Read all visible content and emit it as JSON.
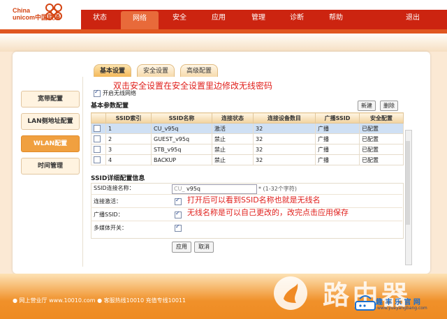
{
  "brand": {
    "line1": "China",
    "line2": "unicom中国联通",
    "color": "#d44412"
  },
  "nav": {
    "items": [
      {
        "label": "状态",
        "x": 0
      },
      {
        "label": "网络",
        "active": true
      },
      {
        "label": "安全"
      },
      {
        "label": "应用"
      },
      {
        "label": "管理"
      },
      {
        "label": "诊断"
      },
      {
        "label": "帮助"
      }
    ],
    "logout": "退出"
  },
  "tabs": [
    {
      "label": "基本设置",
      "active": true
    },
    {
      "label": "安全设置"
    },
    {
      "label": "高级配置"
    }
  ],
  "sidebar": {
    "items": [
      {
        "label": "宽带配置"
      },
      {
        "label": "LAN侧地址配置"
      },
      {
        "label": "WLAN配置",
        "active": true
      },
      {
        "label": "时间管理"
      }
    ]
  },
  "annotations": {
    "top": "双击安全设置在安全设置里边修改无线密码",
    "mid1": "打开后可以看到SSID名称也就是无线名",
    "mid2": "无线名称是可以自己更改的，改完点击应用保存"
  },
  "wlan": {
    "enable_label": "开启无线网络",
    "basic_title": "基本参数配置",
    "new_button": "新建",
    "delete_button": "删除",
    "columns": [
      "",
      "SSID索引",
      "SSID名称",
      "连接状态",
      "连接设备数目",
      "广播SSID",
      "安全配置"
    ],
    "rows": [
      {
        "index": "1",
        "name": "CU_v95q",
        "status": "激活",
        "devices": "32",
        "broadcast": "广播",
        "security": "已配置",
        "selected": true
      },
      {
        "index": "2",
        "name": "GUEST_v95q",
        "status": "禁止",
        "devices": "32",
        "broadcast": "广播",
        "security": "已配置"
      },
      {
        "index": "3",
        "name": "STB_v95q",
        "status": "禁止",
        "devices": "32",
        "broadcast": "广播",
        "security": "已配置"
      },
      {
        "index": "4",
        "name": "BACKUP",
        "status": "禁止",
        "devices": "32",
        "broadcast": "广播",
        "security": "已配置"
      }
    ],
    "detail_title": "SSID详细配置信息",
    "detail": {
      "ssid_name_label": "SSID连接名称：",
      "ssid_prefix": "CU_",
      "ssid_value": "v95q",
      "ssid_hint": "* (1-32个字符)",
      "activate_label": "连接激活：",
      "broadcast_label": "广播SSID：",
      "multimedia_label": "多媒体开关："
    },
    "apply_button": "应用",
    "cancel_button": "取消"
  },
  "footer": {
    "text": "● 网上营业厅  www.10010.com  ● 客服热线10010  充值专线10011"
  },
  "watermark": {
    "big": "路由器",
    "small": "趣 丰 乐 官 网",
    "url": "www.yueyangbang.com"
  }
}
